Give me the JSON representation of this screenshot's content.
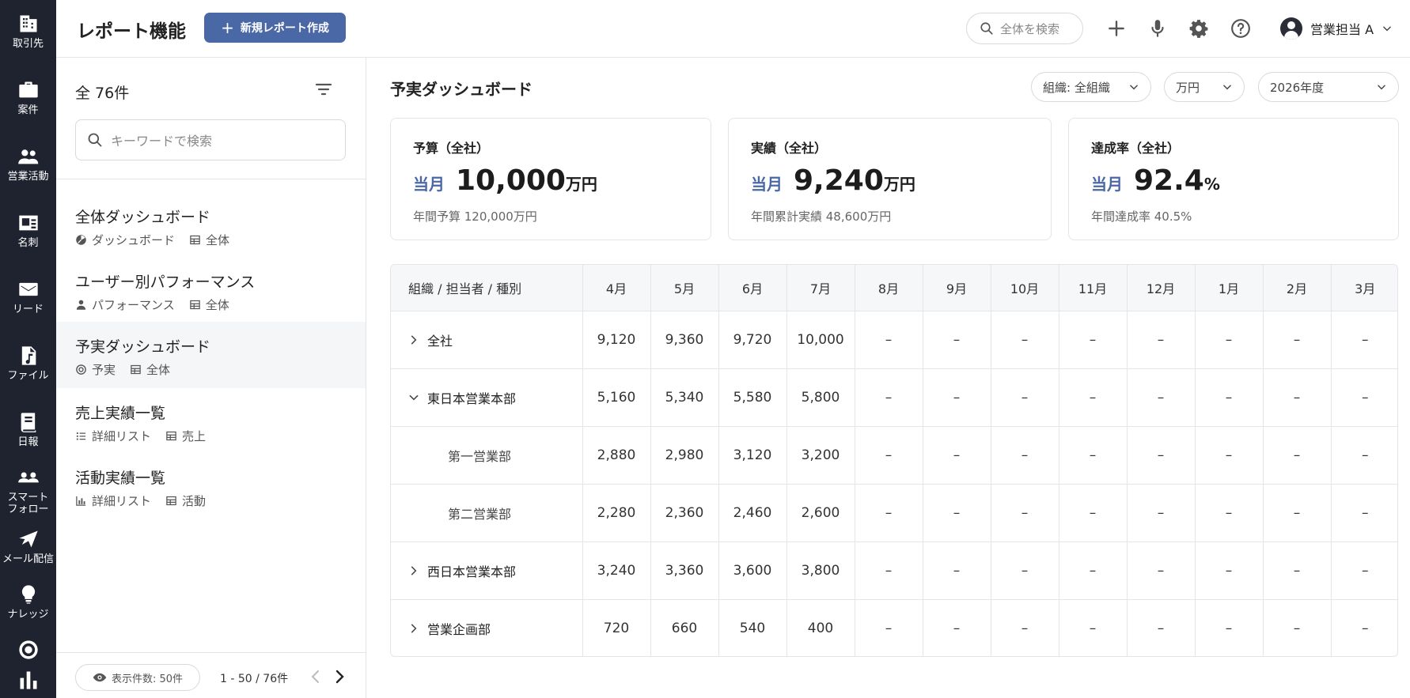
{
  "rail": {
    "items": [
      {
        "label": "取引先",
        "icon": "building-icon"
      },
      {
        "label": "案件",
        "icon": "briefcase-icon"
      },
      {
        "label": "営業活動",
        "icon": "people-icon"
      },
      {
        "label": "名刺",
        "icon": "contact-card-icon"
      },
      {
        "label": "リード",
        "icon": "envelope-icon"
      },
      {
        "label": "ファイル",
        "icon": "file-music-icon"
      },
      {
        "label": "日報",
        "icon": "book-icon"
      },
      {
        "label": "スマート\nフォロー",
        "icon": "group-icon"
      },
      {
        "label": "メール配信",
        "icon": "paper-plane-icon"
      },
      {
        "label": "ナレッジ",
        "icon": "lightbulb-icon"
      },
      {
        "label": "",
        "icon": "target-icon"
      },
      {
        "label": "",
        "icon": "bar-chart-icon"
      }
    ]
  },
  "header": {
    "title": "レポート機能",
    "new_button": "新規レポート作成",
    "search_placeholder": "全体を検索",
    "user_name": "営業担当 A"
  },
  "list": {
    "count_label": "全 76件",
    "search_placeholder": "キーワードで検索",
    "items": [
      {
        "title": "全体ダッシュボード",
        "type": "ダッシュボード",
        "type_icon": "pie-chart-icon",
        "scope": "全体",
        "scope_icon": "table-icon"
      },
      {
        "title": "ユーザー別パフォーマンス",
        "type": "パフォーマンス",
        "type_icon": "person-icon",
        "scope": "全体",
        "scope_icon": "table-icon"
      },
      {
        "title": "予実ダッシュボード",
        "type": "予実",
        "type_icon": "target-icon",
        "scope": "全体",
        "scope_icon": "table-icon"
      },
      {
        "title": "売上実績一覧",
        "type": "詳細リスト",
        "type_icon": "list-icon",
        "scope": "売上",
        "scope_icon": "table-icon"
      },
      {
        "title": "活動実績一覧",
        "type": "詳細リスト",
        "type_icon": "bar-chart-icon",
        "scope": "活動",
        "scope_icon": "table-icon"
      }
    ],
    "active_index": 2,
    "per_page": "表示件数: 50件",
    "range": "1 - 50 / 76件"
  },
  "main": {
    "title": "予実ダッシュボード",
    "filters": {
      "org": "組織: 全組織",
      "unit": "万円",
      "year": "2026年度"
    },
    "kpis": [
      {
        "title": "予算（全社）",
        "current_label": "当月",
        "value": "10,000",
        "unit": "万円",
        "sub": "年間予算  120,000万円"
      },
      {
        "title": "実績（全社）",
        "current_label": "当月",
        "value": "9,240",
        "unit": "万円",
        "sub": "年間累計実績  48,600万円"
      },
      {
        "title": "達成率（全社）",
        "current_label": "当月",
        "value": "92.4",
        "unit": "%",
        "sub": "年間達成率  40.5%"
      }
    ],
    "table": {
      "header_first": "組織 / 担当者 / 種別",
      "months": [
        "4月",
        "5月",
        "6月",
        "7月",
        "8月",
        "9月",
        "10月",
        "11月",
        "12月",
        "1月",
        "2月",
        "3月"
      ],
      "rows": [
        {
          "label": "全社",
          "level": 0,
          "toggle": "collapsed",
          "values": [
            "9,120",
            "9,360",
            "9,720",
            "10,000",
            "–",
            "–",
            "–",
            "–",
            "–",
            "–",
            "–",
            "–"
          ]
        },
        {
          "label": "東日本営業本部",
          "level": 0,
          "toggle": "expanded",
          "values": [
            "5,160",
            "5,340",
            "5,580",
            "5,800",
            "–",
            "–",
            "–",
            "–",
            "–",
            "–",
            "–",
            "–"
          ]
        },
        {
          "label": "第一営業部",
          "level": 1,
          "toggle": "none",
          "values": [
            "2,880",
            "2,980",
            "3,120",
            "3,200",
            "–",
            "–",
            "–",
            "–",
            "–",
            "–",
            "–",
            "–"
          ]
        },
        {
          "label": "第二営業部",
          "level": 1,
          "toggle": "none",
          "values": [
            "2,280",
            "2,360",
            "2,460",
            "2,600",
            "–",
            "–",
            "–",
            "–",
            "–",
            "–",
            "–",
            "–"
          ]
        },
        {
          "label": "西日本営業本部",
          "level": 0,
          "toggle": "collapsed",
          "values": [
            "3,240",
            "3,360",
            "3,600",
            "3,800",
            "–",
            "–",
            "–",
            "–",
            "–",
            "–",
            "–",
            "–"
          ]
        },
        {
          "label": "営業企画部",
          "level": 0,
          "toggle": "collapsed",
          "values": [
            "720",
            "660",
            "540",
            "400",
            "–",
            "–",
            "–",
            "–",
            "–",
            "–",
            "–",
            "–"
          ]
        }
      ]
    }
  },
  "colors": {
    "rail_bg": "#1f2330",
    "accent": "#4a68a6",
    "border": "#e3e5ea"
  }
}
